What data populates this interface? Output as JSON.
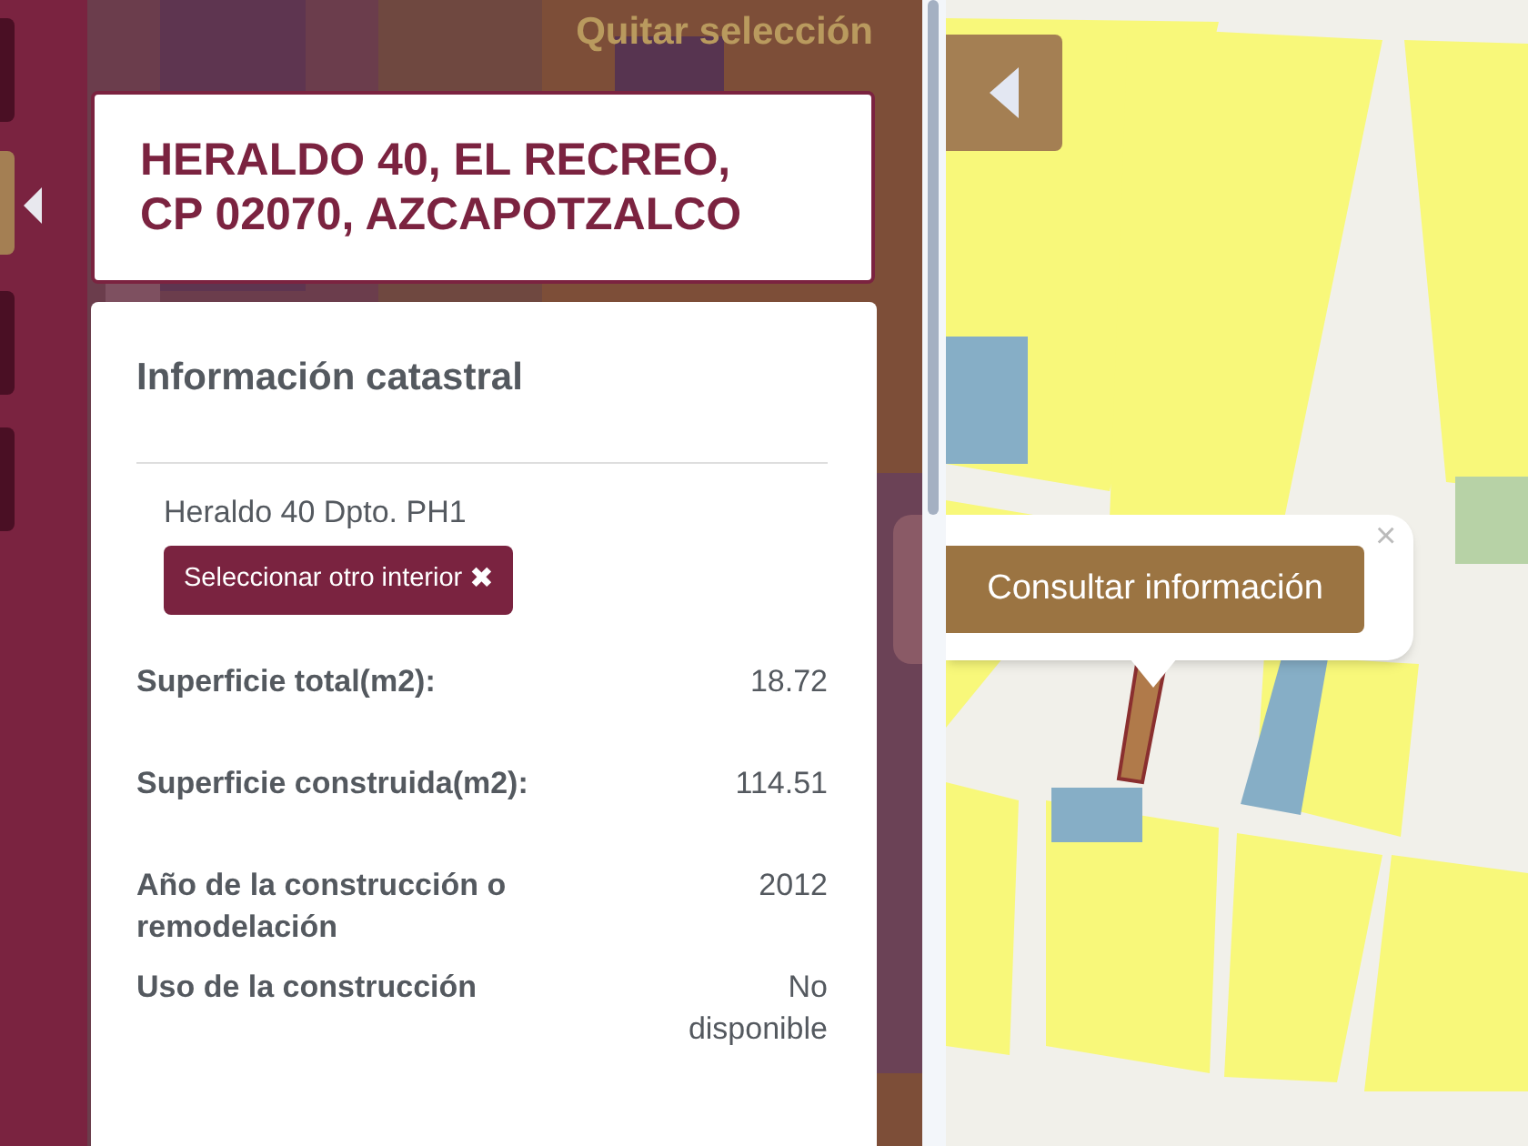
{
  "sidebar": {
    "tabs": [
      {
        "selected": false
      },
      {
        "selected": true
      },
      {
        "selected": false
      },
      {
        "selected": false
      }
    ]
  },
  "panel": {
    "clear_selection": "Quitar selección",
    "address": "HERALDO 40, EL RECREO, CP 02070, AZCAPOTZALCO",
    "card": {
      "title": "Información catastral",
      "unit": "Heraldo 40 Dpto. PH1",
      "change_button": "Seleccionar otro interior",
      "change_icon": "✖",
      "rows": [
        {
          "label": "Superficie total(m2):",
          "value": "18.72"
        },
        {
          "label": "Superficie construida(m2):",
          "value": "114.51"
        },
        {
          "label": "Año de la construcción o remodelación",
          "value": "2012"
        },
        {
          "label": "Uso de la construcción",
          "value": "No disponible"
        }
      ]
    }
  },
  "map": {
    "popup": {
      "close": "×",
      "button": "Consultar información"
    }
  }
}
